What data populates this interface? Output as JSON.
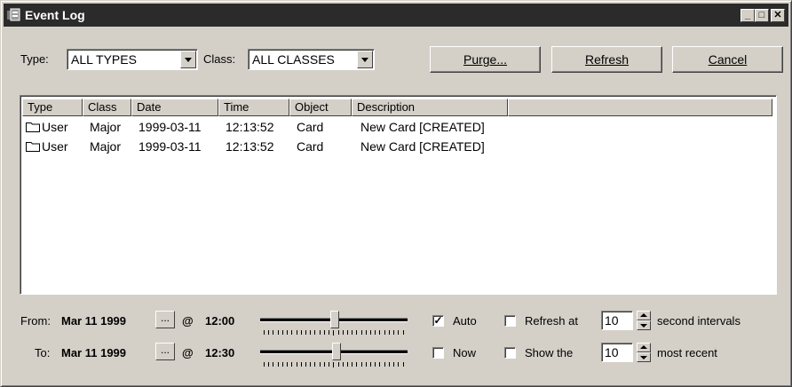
{
  "window": {
    "title": "Event Log",
    "minimize": "_",
    "maximize": "□",
    "close": "✕"
  },
  "filters": {
    "type_label": "Type:",
    "type_value": "ALL TYPES",
    "class_label": "Class:",
    "class_value": "ALL CLASSES"
  },
  "buttons": {
    "purge": "Purge...",
    "refresh": "Refresh",
    "cancel": "Cancel"
  },
  "table": {
    "columns": [
      "Type",
      "Class",
      "Date",
      "Time",
      "Object",
      "Description"
    ],
    "rows": [
      {
        "type": "User",
        "class": "Major",
        "date": "1999-03-11",
        "time": "12:13:52",
        "object": "Card",
        "description": "New Card [CREATED]"
      },
      {
        "type": "User",
        "class": "Major",
        "date": "1999-03-11",
        "time": "12:13:52",
        "object": "Card",
        "description": "New Card [CREATED]"
      }
    ]
  },
  "range": {
    "from_label": "From:",
    "from_date": "Mar 11 1999",
    "from_at": "@",
    "from_time": "12:00",
    "to_label": "To:",
    "to_date": "Mar 11 1999",
    "to_at": "@",
    "to_time": "12:30",
    "browse": "...",
    "from_slider_pct": 50,
    "to_slider_pct": 51
  },
  "options": {
    "auto_label": "Auto",
    "auto_checked": true,
    "now_label": "Now",
    "now_checked": false,
    "refresh_at_label": "Refresh at",
    "refresh_at_checked": false,
    "refresh_value": "10",
    "refresh_suffix": "second intervals",
    "show_the_label": "Show the",
    "show_the_checked": false,
    "show_value": "10",
    "show_suffix": "most recent"
  }
}
